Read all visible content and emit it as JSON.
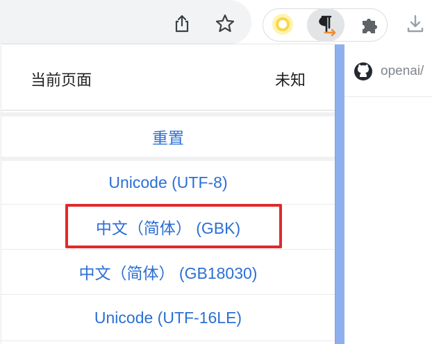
{
  "toolbar": {
    "icons": [
      "share-icon",
      "star-icon",
      "yellow-extension-icon",
      "pilcrow-encoding-icon",
      "puzzle-icon",
      "download-icon"
    ]
  },
  "background_page": {
    "tab_text": "openai/"
  },
  "popup": {
    "current_page_label": "当前页面",
    "current_page_value": "未知",
    "reset_label": "重置",
    "options": [
      "Unicode (UTF-8)",
      "中文（简体） (GBK)",
      "中文（简体） (GB18030)",
      "Unicode (UTF-16LE)"
    ],
    "highlighted_option": "中文（简体） (GBK)"
  },
  "colors": {
    "link_blue": "#2b6fd6",
    "highlight_red": "#e02a2a",
    "page_strip": "#8fb0ef",
    "encoding_arrow": "#f28b30"
  }
}
